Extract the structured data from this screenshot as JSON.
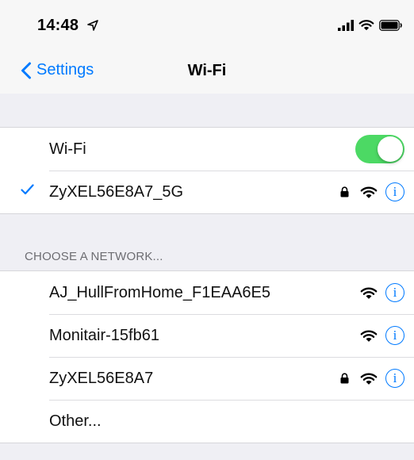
{
  "status_bar": {
    "time": "14:48"
  },
  "nav": {
    "back_label": "Settings",
    "title": "Wi-Fi"
  },
  "wifi_toggle": {
    "label": "Wi-Fi",
    "on": true
  },
  "connected_network": {
    "name": "ZyXEL56E8A7_5G",
    "secured": true
  },
  "section_header": "CHOOSE A NETWORK...",
  "networks": [
    {
      "name": "AJ_HullFromHome_F1EAA6E5",
      "secured": false
    },
    {
      "name": "Monitair-15fb61",
      "secured": false
    },
    {
      "name": "ZyXEL56E8A7",
      "secured": true
    }
  ],
  "other_label": "Other...",
  "colors": {
    "accent": "#007aff",
    "toggle_on": "#4cd964",
    "background": "#efeff4"
  }
}
